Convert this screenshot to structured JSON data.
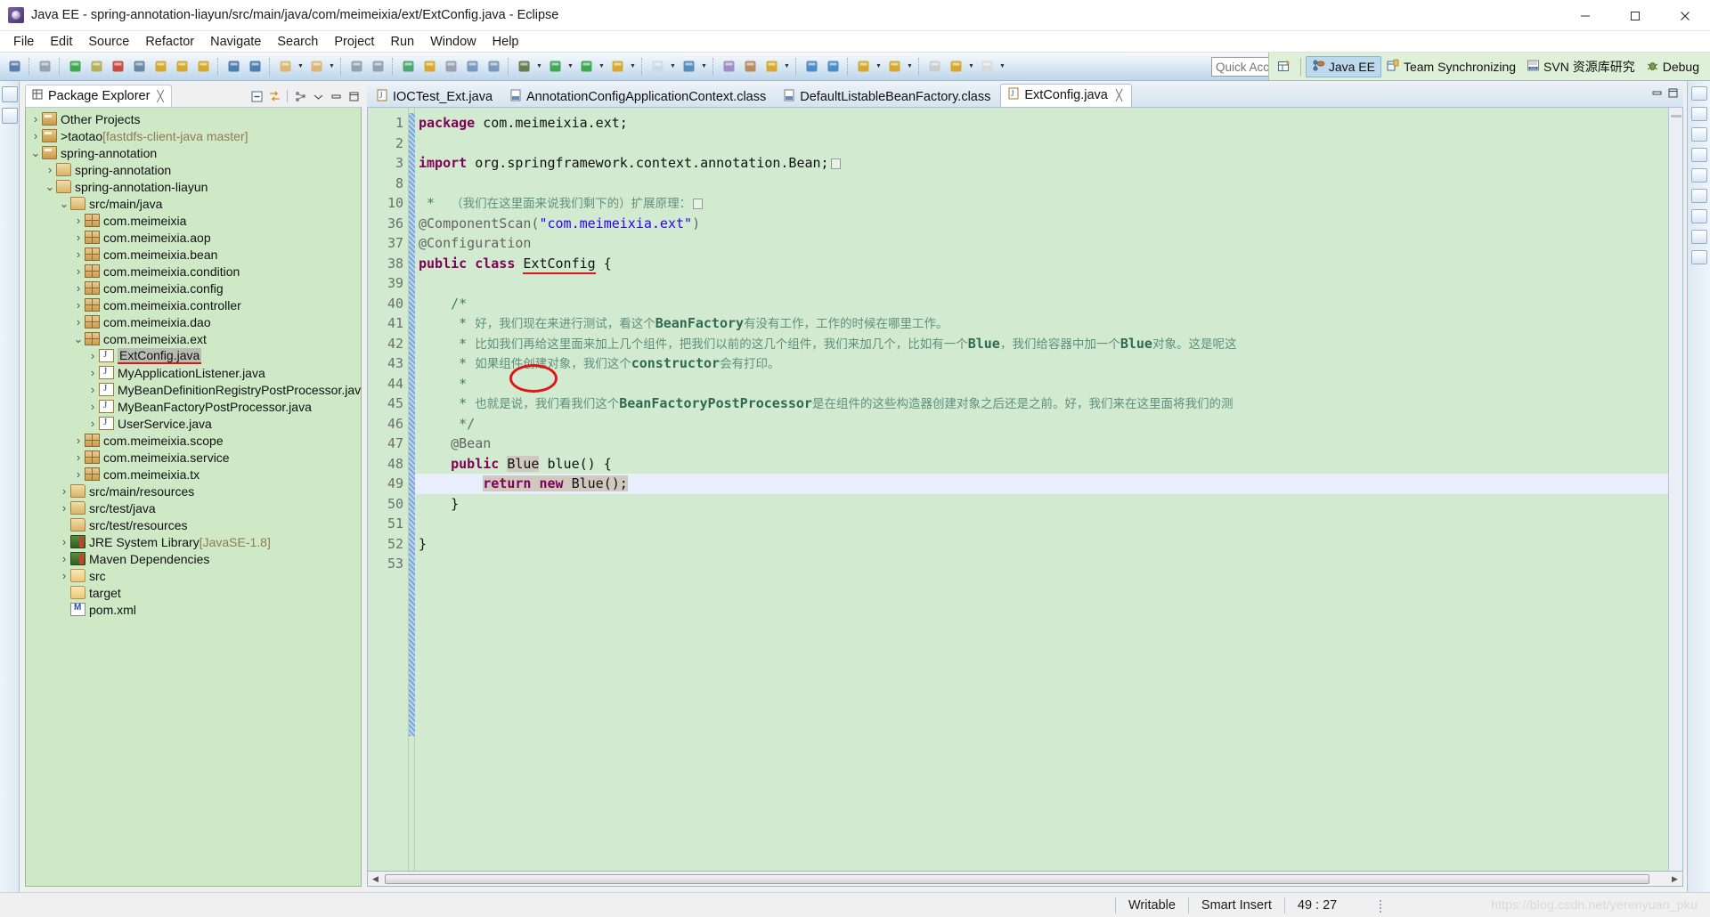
{
  "window": {
    "title": "Java EE - spring-annotation-liayun/src/main/java/com/meimeixia/ext/ExtConfig.java - Eclipse",
    "app_icon": "eclipse-icon",
    "minimize": "—",
    "maximize": "▭",
    "close": "✕"
  },
  "menubar": {
    "items": [
      {
        "label": "File"
      },
      {
        "label": "Edit"
      },
      {
        "label": "Source"
      },
      {
        "label": "Refactor"
      },
      {
        "label": "Navigate"
      },
      {
        "label": "Search"
      },
      {
        "label": "Project"
      },
      {
        "label": "Run"
      },
      {
        "label": "Window"
      },
      {
        "label": "Help"
      }
    ]
  },
  "toolbar": {
    "quick_access_placeholder": "Quick Access",
    "groups": [
      {
        "buttons": [
          {
            "icon": "new-wizard-icon",
            "color": "#4a6fa5"
          }
        ]
      },
      {
        "buttons": [
          {
            "icon": "no-breakpoint-icon",
            "color": "#8f9aa5"
          }
        ]
      },
      {
        "buttons": [
          {
            "icon": "resume-icon",
            "color": "#2d9e3f"
          },
          {
            "icon": "suspend-icon",
            "color": "#b0a94a"
          },
          {
            "icon": "terminate-icon",
            "color": "#c0392b"
          },
          {
            "icon": "disconnect-icon",
            "color": "#5b7c9d"
          },
          {
            "icon": "step-into-icon",
            "color": "#d4a017"
          },
          {
            "icon": "step-over-icon",
            "color": "#d4a017"
          },
          {
            "icon": "step-return-icon",
            "color": "#d4a017"
          }
        ]
      },
      {
        "buttons": [
          {
            "icon": "open-task-icon",
            "color": "#3b6ea5"
          },
          {
            "icon": "new-task-icon",
            "color": "#3b6ea5"
          }
        ]
      },
      {
        "buttons": [
          {
            "icon": "new-java-package-icon",
            "color": "#d9b168",
            "has_arrow": true
          },
          {
            "icon": "new-java-class-icon",
            "color": "#d9b168",
            "has_arrow": true
          }
        ]
      },
      {
        "buttons": [
          {
            "icon": "save-icon",
            "color": "#8899aa"
          },
          {
            "icon": "save-all-icon",
            "color": "#8899aa"
          }
        ]
      },
      {
        "buttons": [
          {
            "icon": "validate-icon",
            "color": "#3b9e5e"
          },
          {
            "icon": "run-ant-icon",
            "color": "#d4a017"
          },
          {
            "icon": "skip-breakpoints-icon",
            "color": "#8f9aa5"
          },
          {
            "icon": "open-type-icon",
            "color": "#6a8fb5"
          },
          {
            "icon": "open-task-list-icon",
            "color": "#6a8fb5"
          }
        ]
      },
      {
        "buttons": [
          {
            "icon": "debug-icon",
            "color": "#5a6e3f",
            "has_arrow": true
          },
          {
            "icon": "run-icon",
            "color": "#2d9e3f",
            "has_arrow": true
          },
          {
            "icon": "run-last-icon",
            "color": "#2d9e3f",
            "has_arrow": true
          },
          {
            "icon": "coverage-icon",
            "color": "#d4a017",
            "has_arrow": true
          }
        ]
      },
      {
        "buttons": [
          {
            "icon": "new-wizard2-icon",
            "color": "#c8d8e8",
            "has_arrow": true
          },
          {
            "icon": "new-web-icon",
            "color": "#4a7fb5",
            "has_arrow": true
          }
        ]
      },
      {
        "buttons": [
          {
            "icon": "open-perspective-icon",
            "color": "#9a7fc0"
          },
          {
            "icon": "print-icon",
            "color": "#b08050"
          },
          {
            "icon": "search-icon",
            "color": "#d4a017",
            "has_arrow": true
          }
        ]
      },
      {
        "buttons": [
          {
            "icon": "open-browser-icon",
            "color": "#3a7fc0"
          },
          {
            "icon": "external-tools-icon",
            "color": "#3a7fc0"
          }
        ]
      },
      {
        "buttons": [
          {
            "icon": "download-icon",
            "color": "#d4a017",
            "has_arrow": true
          },
          {
            "icon": "annotation-icon",
            "color": "#d4a017",
            "has_arrow": true
          }
        ]
      },
      {
        "buttons": [
          {
            "icon": "previous-edit-icon",
            "color": "#c8c8c8"
          },
          {
            "icon": "back-icon",
            "color": "#d4a017",
            "has_arrow": true
          },
          {
            "icon": "forward-icon",
            "color": "#d8d8d8",
            "has_arrow": true
          }
        ]
      }
    ]
  },
  "perspective_bar": {
    "open_perspective_icon": "open-perspective-icon",
    "items": [
      {
        "label": "Java EE",
        "icon": "java-ee-icon",
        "active": true
      },
      {
        "label": "Team Synchronizing",
        "icon": "team-sync-icon",
        "active": false
      },
      {
        "label": "SVN 资源库研究",
        "icon": "svn-icon",
        "active": false
      },
      {
        "label": "Debug",
        "icon": "debug-perspective-icon",
        "active": false
      }
    ]
  },
  "package_explorer": {
    "tab_label": "Package Explorer",
    "tab_icon": "package-explorer-icon",
    "tab_close": "✕",
    "toolbar": [
      {
        "icon": "collapse-all-icon"
      },
      {
        "icon": "link-with-editor-icon"
      },
      {
        "icon": "view-menu-hierarchy-icon"
      },
      {
        "icon": "view-menu-icon"
      },
      {
        "icon": "minimize-view-icon"
      },
      {
        "icon": "maximize-view-icon"
      }
    ],
    "tree": [
      {
        "label": "Other Projects",
        "icon": "project-icon",
        "indent": 0,
        "arrow": "collapsed"
      },
      {
        "label": "taotao",
        "prefix": "> ",
        "suffix": "[fastdfs-client-java master]",
        "icon": "project-icon",
        "indent": 0,
        "arrow": "collapsed"
      },
      {
        "label": "spring-annotation",
        "icon": "project-icon",
        "indent": 0,
        "arrow": "expanded"
      },
      {
        "label": "spring-annotation",
        "icon": "maven-module-icon",
        "indent": 1,
        "arrow": "collapsed"
      },
      {
        "label": "spring-annotation-liayun",
        "icon": "maven-module-icon",
        "indent": 1,
        "arrow": "expanded"
      },
      {
        "label": "src/main/java",
        "icon": "source-folder-icon",
        "indent": 2,
        "arrow": "expanded"
      },
      {
        "label": "com.meimeixia",
        "icon": "package-icon",
        "indent": 3,
        "arrow": "collapsed"
      },
      {
        "label": "com.meimeixia.aop",
        "icon": "package-icon",
        "indent": 3,
        "arrow": "collapsed"
      },
      {
        "label": "com.meimeixia.bean",
        "icon": "package-icon",
        "indent": 3,
        "arrow": "collapsed"
      },
      {
        "label": "com.meimeixia.condition",
        "icon": "package-icon",
        "indent": 3,
        "arrow": "collapsed"
      },
      {
        "label": "com.meimeixia.config",
        "icon": "package-icon",
        "indent": 3,
        "arrow": "collapsed"
      },
      {
        "label": "com.meimeixia.controller",
        "icon": "package-icon",
        "indent": 3,
        "arrow": "collapsed"
      },
      {
        "label": "com.meimeixia.dao",
        "icon": "package-icon",
        "indent": 3,
        "arrow": "collapsed"
      },
      {
        "label": "com.meimeixia.ext",
        "icon": "package-icon",
        "indent": 3,
        "arrow": "expanded"
      },
      {
        "label": "ExtConfig.java",
        "icon": "java-file-icon",
        "indent": 4,
        "arrow": "collapsed",
        "selected": true,
        "underlined": true
      },
      {
        "label": "MyApplicationListener.java",
        "icon": "java-file-icon",
        "indent": 4,
        "arrow": "collapsed"
      },
      {
        "label": "MyBeanDefinitionRegistryPostProcessor.java",
        "icon": "java-file-icon",
        "indent": 4,
        "arrow": "collapsed"
      },
      {
        "label": "MyBeanFactoryPostProcessor.java",
        "icon": "java-file-icon",
        "indent": 4,
        "arrow": "collapsed"
      },
      {
        "label": "UserService.java",
        "icon": "java-file-icon",
        "indent": 4,
        "arrow": "collapsed"
      },
      {
        "label": "com.meimeixia.scope",
        "icon": "package-icon",
        "indent": 3,
        "arrow": "collapsed"
      },
      {
        "label": "com.meimeixia.service",
        "icon": "package-icon",
        "indent": 3,
        "arrow": "collapsed"
      },
      {
        "label": "com.meimeixia.tx",
        "icon": "package-icon",
        "indent": 3,
        "arrow": "collapsed"
      },
      {
        "label": "src/main/resources",
        "icon": "source-folder-icon",
        "indent": 2,
        "arrow": "collapsed"
      },
      {
        "label": "src/test/java",
        "icon": "source-folder-icon",
        "indent": 2,
        "arrow": "collapsed"
      },
      {
        "label": "src/test/resources",
        "icon": "source-folder-icon",
        "indent": 2,
        "arrow": "none"
      },
      {
        "label": "JRE System Library",
        "suffix": "[JavaSE-1.8]",
        "icon": "library-icon",
        "indent": 2,
        "arrow": "collapsed"
      },
      {
        "label": "Maven Dependencies",
        "icon": "library-icon",
        "indent": 2,
        "arrow": "collapsed"
      },
      {
        "label": "src",
        "icon": "folder-icon",
        "indent": 2,
        "arrow": "collapsed"
      },
      {
        "label": "target",
        "icon": "folder-icon",
        "indent": 2,
        "arrow": "none"
      },
      {
        "label": "pom.xml",
        "icon": "maven-pom-icon",
        "indent": 2,
        "arrow": "none"
      }
    ]
  },
  "editor": {
    "tabs": [
      {
        "label": "IOCTest_Ext.java",
        "icon": "java-file-icon",
        "active": false
      },
      {
        "label": "AnnotationConfigApplicationContext.class",
        "icon": "class-file-icon",
        "active": false
      },
      {
        "label": "DefaultListableBeanFactory.class",
        "icon": "class-file-icon",
        "active": false
      },
      {
        "label": "ExtConfig.java",
        "icon": "java-file-icon",
        "active": true,
        "close": "✕"
      }
    ],
    "lines": [
      {
        "num": "1",
        "fold": "",
        "segments": [
          {
            "t": "package ",
            "c": "kw"
          },
          {
            "t": "com.meimeixia.ext;",
            "c": ""
          }
        ]
      },
      {
        "num": "2",
        "fold": "",
        "segments": []
      },
      {
        "num": "3",
        "fold": "+",
        "segments": [
          {
            "t": "import ",
            "c": "kw"
          },
          {
            "t": "org.springframework.context.annotation.Bean;",
            "c": ""
          },
          {
            "t": "FOLDBOX",
            "c": "foldbox"
          }
        ]
      },
      {
        "num": "8",
        "fold": "",
        "segments": []
      },
      {
        "num": "10",
        "fold": "+",
        "segments": [
          {
            "t": " *  ",
            "c": "cmt"
          },
          {
            "t": "（我们在这里面来说我们剩下的）扩展原理：",
            "c": "cmt-cn"
          },
          {
            "t": "FOLDBOX",
            "c": "foldbox"
          }
        ]
      },
      {
        "num": "36",
        "fold": "",
        "segments": [
          {
            "t": "@ComponentScan(",
            "c": "ann"
          },
          {
            "t": "\"com.meimeixia.ext\"",
            "c": "str"
          },
          {
            "t": ")",
            "c": "ann"
          }
        ]
      },
      {
        "num": "37",
        "fold": "",
        "segments": [
          {
            "t": "@Configuration",
            "c": "ann"
          }
        ]
      },
      {
        "num": "38",
        "fold": "",
        "segments": [
          {
            "t": "public class ",
            "c": "kw"
          },
          {
            "t": "ExtConfig",
            "c": "u-red"
          },
          {
            "t": " {",
            "c": ""
          }
        ]
      },
      {
        "num": "39",
        "fold": "",
        "segments": []
      },
      {
        "num": "40",
        "fold": "-",
        "segments": [
          {
            "t": "    /*",
            "c": "cmt"
          }
        ]
      },
      {
        "num": "41",
        "fold": "",
        "segments": [
          {
            "t": "     * ",
            "c": "cmt"
          },
          {
            "t": "好，我们现在来进行测试，看这个",
            "c": "cmt-cn"
          },
          {
            "t": "BeanFactory",
            "c": "cmt-code"
          },
          {
            "t": "有没有工作，工作的时候在哪里工作。",
            "c": "cmt-cn"
          }
        ]
      },
      {
        "num": "42",
        "fold": "",
        "segments": [
          {
            "t": "     * ",
            "c": "cmt"
          },
          {
            "t": "比如我们再给这里面来加上几个组件，把我们以前的这几个组件，我们来加几个，比如有一个",
            "c": "cmt-cn"
          },
          {
            "t": "Blue",
            "c": "cmt-code"
          },
          {
            "t": "，我们给容器中加一个",
            "c": "cmt-cn"
          },
          {
            "t": "Blue",
            "c": "cmt-code"
          },
          {
            "t": "对象。这是呢这",
            "c": "cmt-cn"
          }
        ]
      },
      {
        "num": "43",
        "fold": "",
        "segments": [
          {
            "t": "     * ",
            "c": "cmt"
          },
          {
            "t": "如果组件创建对象，我们这个",
            "c": "cmt-cn"
          },
          {
            "t": "constructor",
            "c": "cmt-code"
          },
          {
            "t": "会有打印。",
            "c": "cmt-cn"
          }
        ]
      },
      {
        "num": "44",
        "fold": "",
        "segments": [
          {
            "t": "     *",
            "c": "cmt"
          }
        ]
      },
      {
        "num": "45",
        "fold": "",
        "segments": [
          {
            "t": "     * ",
            "c": "cmt"
          },
          {
            "t": "也就是说，我们看我们这个",
            "c": "cmt-cn"
          },
          {
            "t": "BeanFactoryPostProcessor",
            "c": "cmt-code"
          },
          {
            "t": "是在组件的这些构造器创建对象之后还是之前。好，我们来在这里面将我们的测",
            "c": "cmt-cn"
          }
        ]
      },
      {
        "num": "46",
        "fold": "",
        "segments": [
          {
            "t": "     */",
            "c": "cmt"
          }
        ]
      },
      {
        "num": "47",
        "fold": "-",
        "segments": [
          {
            "t": "    @Bean",
            "c": "ann"
          }
        ]
      },
      {
        "num": "48",
        "fold": "",
        "segments": [
          {
            "t": "    ",
            "c": ""
          },
          {
            "t": "public ",
            "c": "kw"
          },
          {
            "t": "Blue",
            "c": "sel-bg"
          },
          {
            "t": " blue() {",
            "c": ""
          }
        ]
      },
      {
        "num": "49",
        "fold": "",
        "highlight": true,
        "segments": [
          {
            "t": "        ",
            "c": ""
          },
          {
            "t": "SELSTART",
            "c": "selstart"
          },
          {
            "t": "return new ",
            "c": "kw"
          },
          {
            "t": "Blue();",
            "c": ""
          },
          {
            "t": "SELEND",
            "c": "selend"
          }
        ]
      },
      {
        "num": "50",
        "fold": "",
        "segments": [
          {
            "t": "    }",
            "c": ""
          }
        ]
      },
      {
        "num": "51",
        "fold": "",
        "segments": []
      },
      {
        "num": "52",
        "fold": "",
        "segments": [
          {
            "t": "}",
            "c": ""
          }
        ]
      },
      {
        "num": "53",
        "fold": "",
        "segments": []
      }
    ],
    "annotation_circle": {
      "label": "red-circle-around-Blue"
    }
  },
  "statusbar": {
    "writable": "Writable",
    "insert_mode": "Smart Insert",
    "position": "49 : 27",
    "watermark": "https://blog.csdn.net/yerenyuan_pku"
  }
}
